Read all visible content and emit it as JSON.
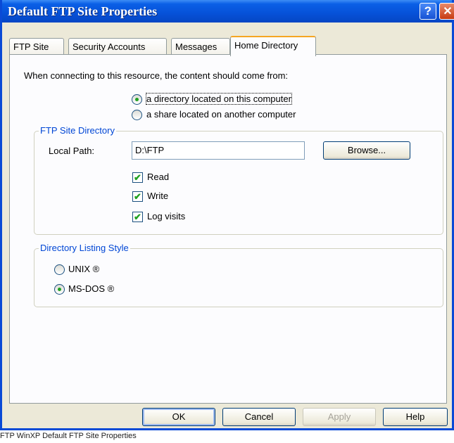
{
  "window": {
    "title": "Default FTP Site Properties",
    "help_glyph": "?",
    "close_glyph": "✕"
  },
  "tabs": [
    {
      "label": "FTP Site"
    },
    {
      "label": "Security Accounts"
    },
    {
      "label": "Messages"
    },
    {
      "label": "Home Directory"
    }
  ],
  "content_source": {
    "prompt": "When connecting to this resource, the content should come from:",
    "option1": {
      "label": "a directory located on this computer",
      "selected": true
    },
    "option2": {
      "label": "a share located on another computer",
      "selected": false
    }
  },
  "ftp_dir": {
    "group_title": "FTP Site Directory",
    "local_path_label": "Local Path:",
    "local_path_value": "D:\\FTP",
    "browse_label": "Browse...",
    "read_label": "Read",
    "write_label": "Write",
    "log_label": "Log visits",
    "check_glyph": "✔"
  },
  "listing": {
    "group_title": "Directory Listing Style",
    "unix_label": "UNIX ®",
    "msdos_label": "MS-DOS ®",
    "selected": "MS-DOS"
  },
  "buttons": {
    "ok": "OK",
    "cancel": "Cancel",
    "apply": "Apply",
    "help": "Help"
  },
  "caption": "FTP WinXP Default FTP Site Properties"
}
